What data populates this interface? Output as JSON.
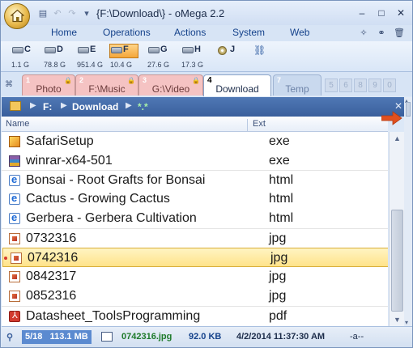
{
  "window": {
    "title": "{F:\\Download\\} - oMega 2.2",
    "controls": [
      "–",
      "□",
      "✕"
    ]
  },
  "ribbon": {
    "tabs": [
      "Home",
      "Operations",
      "Actions",
      "System",
      "Web"
    ]
  },
  "drives": [
    {
      "letter": "C",
      "size": "1.1 G"
    },
    {
      "letter": "D",
      "size": "78.8 G"
    },
    {
      "letter": "E",
      "size": "951.4 G"
    },
    {
      "letter": "F",
      "size": "10.4 G"
    },
    {
      "letter": "G",
      "size": "27.6 G"
    },
    {
      "letter": "H",
      "size": "17.3 G"
    },
    {
      "letter": "J",
      "size": ""
    }
  ],
  "folder_tabs": [
    {
      "num": "1",
      "label": "Photo"
    },
    {
      "num": "2",
      "label": "F:\\Music"
    },
    {
      "num": "3",
      "label": "G:\\Video"
    },
    {
      "num": "4",
      "label": "Download"
    },
    {
      "num": "7",
      "label": "Temp"
    }
  ],
  "tab_slots": [
    "5",
    "6",
    "8",
    "9",
    "0"
  ],
  "path": {
    "drive": "F:",
    "folder": "Download",
    "filter": "*.*"
  },
  "columns": {
    "name": "Name",
    "ext": "Ext"
  },
  "files": [
    {
      "name": "SafariSetup",
      "ext": "exe",
      "icon": "exe-icon"
    },
    {
      "name": "winrar-x64-501",
      "ext": "exe",
      "icon": "winrar-icon"
    },
    {
      "name": "Bonsai - Root Grafts for Bonsai",
      "ext": "html",
      "icon": "ie-html-icon"
    },
    {
      "name": "Cactus - Growing Cactus",
      "ext": "html",
      "icon": "ie-html-icon"
    },
    {
      "name": "Gerbera - Gerbera Cultivation",
      "ext": "html",
      "icon": "ie-html-icon"
    },
    {
      "name": "0732316",
      "ext": "jpg",
      "icon": "image-icon"
    },
    {
      "name": "0742316",
      "ext": "jpg",
      "icon": "image-icon"
    },
    {
      "name": "0842317",
      "ext": "jpg",
      "icon": "image-icon"
    },
    {
      "name": "0852316",
      "ext": "jpg",
      "icon": "image-icon"
    },
    {
      "name": "Datasheet_ToolsProgramming",
      "ext": "pdf",
      "icon": "pdf-icon"
    }
  ],
  "status": {
    "count": "5/18",
    "total_size": "113.1 MB",
    "selected_file": "0742316.jpg",
    "file_size": "92.0 KB",
    "date": "4/2/2014 11:37:30 AM",
    "attributes": "-a--"
  },
  "colors": {
    "accent": "#3a5f9c",
    "selection": "#ffe38a",
    "active_drive": "#f4a63a"
  }
}
